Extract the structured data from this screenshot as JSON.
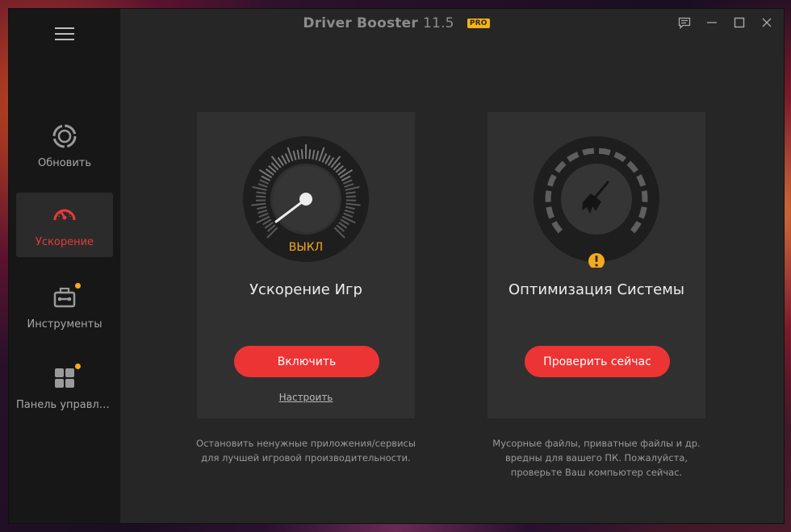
{
  "app": {
    "title": "Driver Booster",
    "version": "11.5",
    "badge": "PRO"
  },
  "window_controls": {
    "feedback_icon": "feedback-icon",
    "minimize_icon": "minimize-icon",
    "maximize_icon": "maximize-icon",
    "close_icon": "close-icon"
  },
  "sidebar": {
    "menu_icon": "hamburger-icon",
    "items": [
      {
        "label": "Обновить",
        "icon": "update-icon",
        "active": false,
        "badge": false
      },
      {
        "label": "Ускорение",
        "icon": "speedometer-icon",
        "active": true,
        "badge": false
      },
      {
        "label": "Инструменты",
        "icon": "toolbox-icon",
        "active": false,
        "badge": true
      },
      {
        "label": "Панель управлен...",
        "icon": "grid-icon",
        "active": false,
        "badge": true
      }
    ]
  },
  "cards": {
    "game_boost": {
      "gauge_status": "ВЫКЛ",
      "title": "Ускорение Игр",
      "button_label": "Включить",
      "link_label": "Настроить",
      "description": [
        "Остановить ненужные приложения/сервисы",
        "для лучшей игровой производительности."
      ]
    },
    "system_optimize": {
      "title": "Оптимизация Системы",
      "button_label": "Проверить сейчас",
      "status_icon": "warning-icon",
      "description": [
        "Мусорные файлы, приватные файлы и др.",
        "вредны для вашего ПК. Пожалуйста,",
        "проверьте Ваш компьютер сейчас."
      ]
    }
  },
  "colors": {
    "accent": "#ec3434",
    "warning": "#f4a91e",
    "pro_badge": "#f2b31b",
    "background": "#262626",
    "sidebar": "#171717",
    "card": "#303030"
  }
}
